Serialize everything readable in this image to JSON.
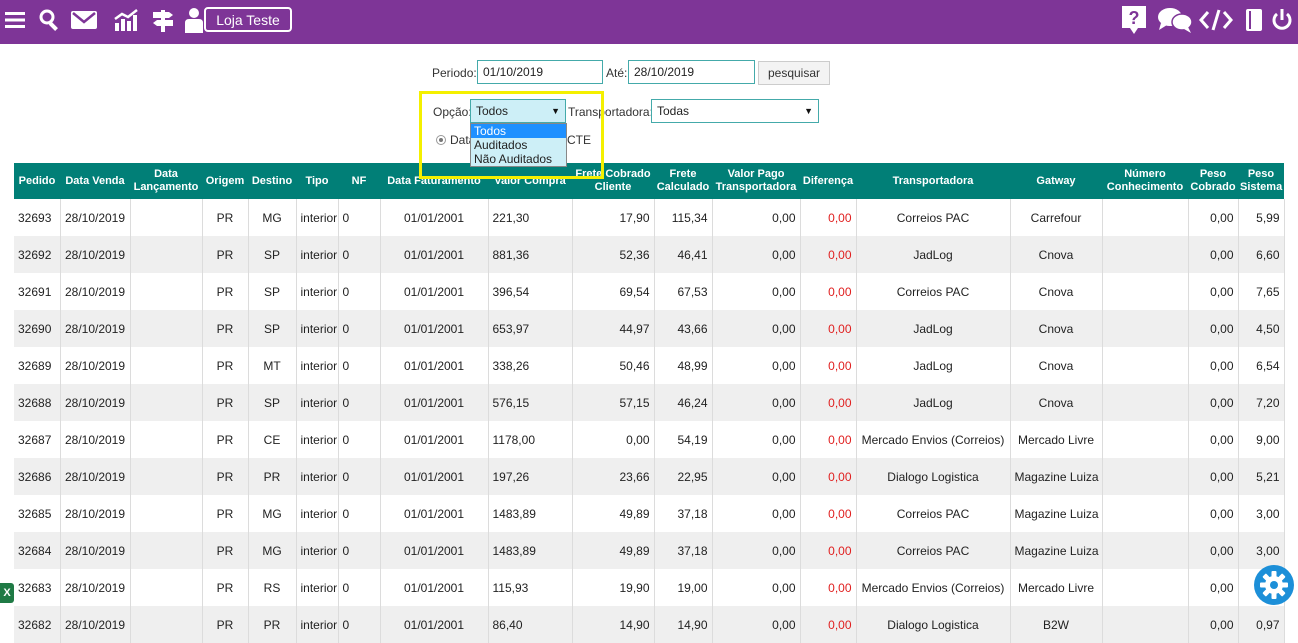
{
  "topbar": {
    "store_label": "Loja Teste",
    "icons_left": [
      "menu-icon",
      "search-icon",
      "mail-icon",
      "chart-icon",
      "signpost-icon",
      "user-icon"
    ],
    "icons_right": [
      "help-icon",
      "chat-icon",
      "code-icon",
      "book-icon",
      "power-icon"
    ],
    "bg_color": "#7e3597"
  },
  "filters": {
    "periodo_label": "Periodo:",
    "periodo_value": "01/10/2019",
    "ate_label": "Até:",
    "ate_value": "28/10/2019",
    "search_button": "pesquisar",
    "opcao_label": "Opção:",
    "opcao_value": "Todos",
    "opcao_options": [
      "Todos",
      "Auditados",
      "Não Auditados"
    ],
    "transportadora_label": "Transportadora:",
    "transportadora_value": "Todas",
    "radio_label": "Data",
    "cte_label": "CTE"
  },
  "table": {
    "headers": [
      "Pedido",
      "Data Venda",
      "Data Lançamento",
      "Origem",
      "Destino",
      "Tipo",
      "NF",
      "Data Faturamento",
      "Valor Compra",
      "Frete Cobrado Cliente",
      "Frete Calculado",
      "Valor Pago Transportadora",
      "Diferença",
      "Transportadora",
      "Gatway",
      "Número Conhecimento",
      "Peso Cobrado",
      "Peso Sistema"
    ],
    "rows": [
      [
        "32693",
        "28/10/2019",
        "",
        "PR",
        "MG",
        "interior",
        "0",
        "01/01/2001",
        "221,30",
        "17,90",
        "115,34",
        "0,00",
        "0,00",
        "Correios PAC",
        "Carrefour",
        "",
        "0,00",
        "5,99"
      ],
      [
        "32692",
        "28/10/2019",
        "",
        "PR",
        "SP",
        "interior",
        "0",
        "01/01/2001",
        "881,36",
        "52,36",
        "46,41",
        "0,00",
        "0,00",
        "JadLog",
        "Cnova",
        "",
        "0,00",
        "6,60"
      ],
      [
        "32691",
        "28/10/2019",
        "",
        "PR",
        "SP",
        "interior",
        "0",
        "01/01/2001",
        "396,54",
        "69,54",
        "67,53",
        "0,00",
        "0,00",
        "Correios PAC",
        "Cnova",
        "",
        "0,00",
        "7,65"
      ],
      [
        "32690",
        "28/10/2019",
        "",
        "PR",
        "SP",
        "interior",
        "0",
        "01/01/2001",
        "653,97",
        "44,97",
        "43,66",
        "0,00",
        "0,00",
        "JadLog",
        "Cnova",
        "",
        "0,00",
        "4,50"
      ],
      [
        "32689",
        "28/10/2019",
        "",
        "PR",
        "MT",
        "interior",
        "0",
        "01/01/2001",
        "338,26",
        "50,46",
        "48,99",
        "0,00",
        "0,00",
        "JadLog",
        "Cnova",
        "",
        "0,00",
        "6,54"
      ],
      [
        "32688",
        "28/10/2019",
        "",
        "PR",
        "SP",
        "interior",
        "0",
        "01/01/2001",
        "576,15",
        "57,15",
        "46,24",
        "0,00",
        "0,00",
        "JadLog",
        "Cnova",
        "",
        "0,00",
        "7,20"
      ],
      [
        "32687",
        "28/10/2019",
        "",
        "PR",
        "CE",
        "interior",
        "0",
        "01/01/2001",
        "1178,00",
        "0,00",
        "54,19",
        "0,00",
        "0,00",
        "Mercado Envios (Correios)",
        "Mercado Livre",
        "",
        "0,00",
        "9,00"
      ],
      [
        "32686",
        "28/10/2019",
        "",
        "PR",
        "PR",
        "interior",
        "0",
        "01/01/2001",
        "197,26",
        "23,66",
        "22,95",
        "0,00",
        "0,00",
        "Dialogo Logistica",
        "Magazine Luiza",
        "",
        "0,00",
        "5,21"
      ],
      [
        "32685",
        "28/10/2019",
        "",
        "PR",
        "MG",
        "interior",
        "0",
        "01/01/2001",
        "1483,89",
        "49,89",
        "37,18",
        "0,00",
        "0,00",
        "Correios PAC",
        "Magazine Luiza",
        "",
        "0,00",
        "3,00"
      ],
      [
        "32684",
        "28/10/2019",
        "",
        "PR",
        "MG",
        "interior",
        "0",
        "01/01/2001",
        "1483,89",
        "49,89",
        "37,18",
        "0,00",
        "0,00",
        "Correios PAC",
        "Magazine Luiza",
        "",
        "0,00",
        "3,00"
      ],
      [
        "32683",
        "28/10/2019",
        "",
        "PR",
        "RS",
        "interior",
        "0",
        "01/01/2001",
        "115,93",
        "19,90",
        "19,00",
        "0,00",
        "0,00",
        "Mercado Envios (Correios)",
        "Mercado Livre",
        "",
        "0,00",
        "0,00"
      ],
      [
        "32682",
        "28/10/2019",
        "",
        "PR",
        "PR",
        "interior",
        "0",
        "01/01/2001",
        "86,40",
        "14,90",
        "14,90",
        "0,00",
        "0,00",
        "Dialogo Logistica",
        "B2W",
        "",
        "0,00",
        "0,97"
      ]
    ]
  },
  "colors": {
    "header_bg": "#017f77",
    "diff_color": "#e02020",
    "highlight": "#f4f000"
  },
  "excel_icon_label": "X"
}
